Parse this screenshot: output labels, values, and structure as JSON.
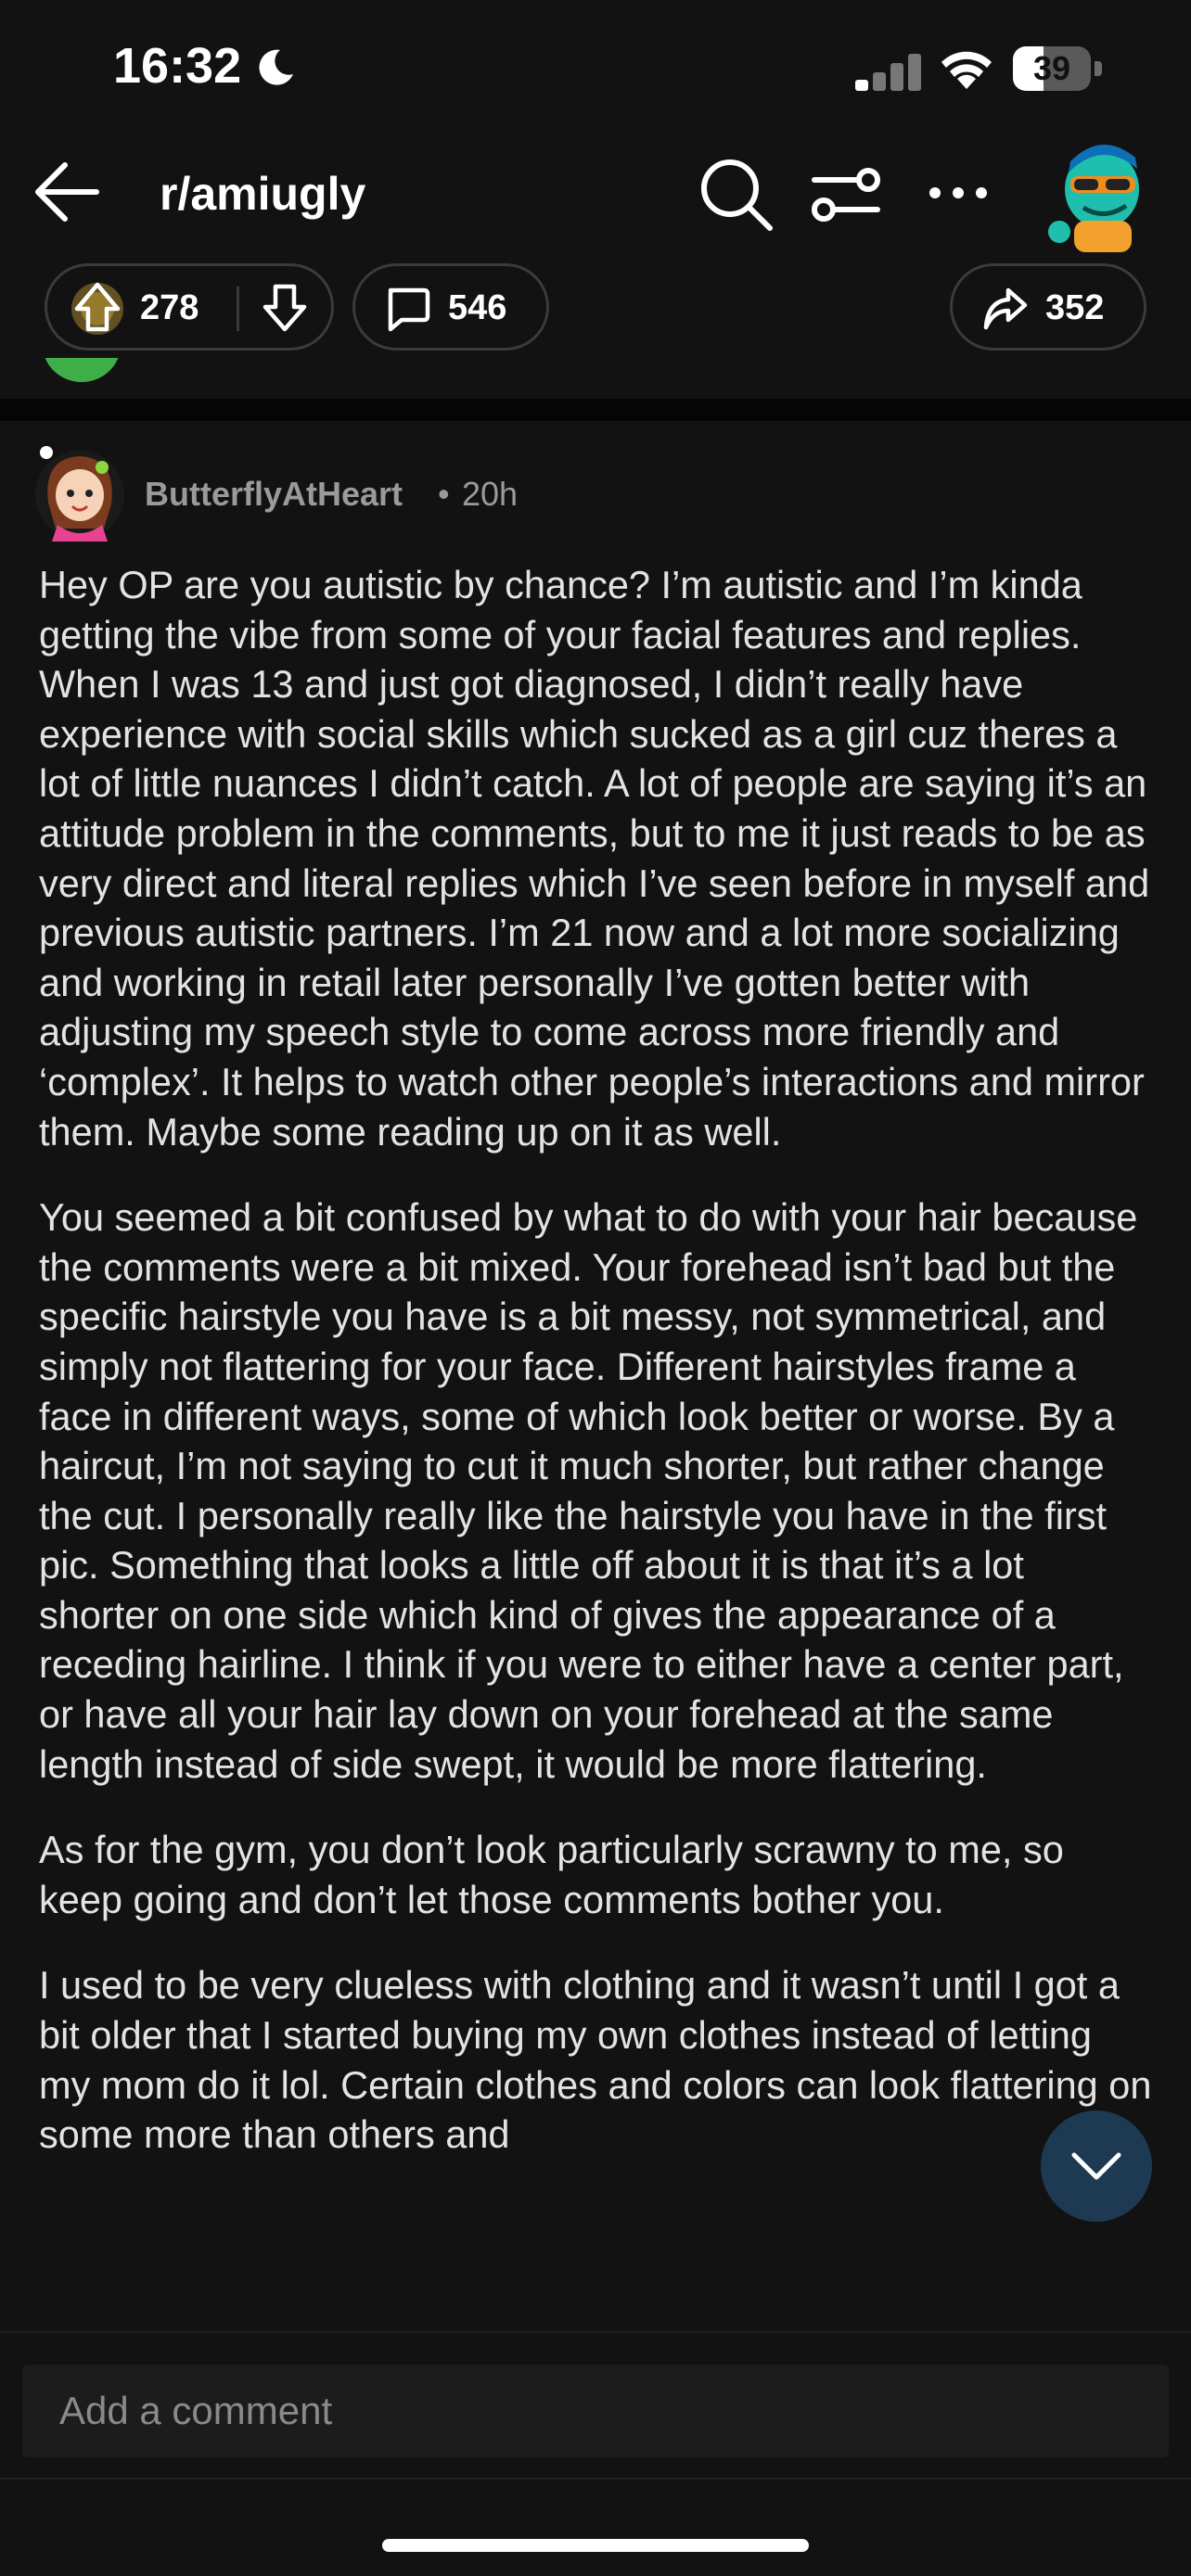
{
  "status_bar": {
    "time": "16:32",
    "battery": "39",
    "battery_level": 0.39
  },
  "nav": {
    "subreddit": "r/amiugly"
  },
  "actions": {
    "upvotes": "278",
    "comments": "546",
    "shares": "352"
  },
  "comment": {
    "author": "ButterflyAtHeart",
    "separator": "•",
    "age": "20h",
    "paragraphs": [
      "Hey OP are you autistic by chance? I’m autistic and I’m kinda getting the vibe from some of your facial features and replies. When I was 13 and just got diagnosed, I didn’t really have experience with social skills which sucked as a girl cuz theres a lot of little nuances I didn’t catch. A lot of people are saying it’s an attitude problem in the comments, but to me it just reads to be as very direct and literal replies which I’ve seen before in myself and previous autistic partners. I’m 21 now and a lot more socializing and working in retail later personally I’ve gotten better with adjusting my speech style to come across more friendly and ‘complex’. It helps to watch other people’s interactions and mirror them. Maybe some reading up on it as well.",
      "You seemed a bit confused by what to do with your hair because the comments were a bit mixed. Your forehead isn’t bad but the specific hairstyle you have is a bit messy, not symmetrical, and simply not flattering for your face. Different hairstyles frame a face in different ways, some of which look better or worse. By a haircut, I’m not saying to cut it much shorter, but rather change the cut. I personally really like the hairstyle you have in the first pic. Something that looks a little off about it is that it’s a lot shorter on one side which kind of gives the appearance of a receding hairline. I think if you were to either have a center part, or have all your hair lay down on your forehead at the same length instead of side swept, it would be more flattering.",
      "As for the gym, you don’t look particularly scrawny to me, so keep going and don’t let those comments bother you.",
      "I used to be very clueless with clothing and it wasn’t until I got a bit older that I started buying my own clothes instead of letting my mom do it lol. Certain clothes and colors can look flattering on some more than others and"
    ]
  },
  "composer": {
    "placeholder": "Add a comment"
  },
  "colors": {
    "background": "#121212",
    "upvote_glow": "#f5c542",
    "fab": "#1e3a52"
  },
  "icons": [
    "moon-icon",
    "signal-icon",
    "wifi-icon",
    "battery-icon",
    "back-arrow-icon",
    "search-icon",
    "filter-icon",
    "more-icon",
    "upvote-icon",
    "downvote-icon",
    "comment-icon",
    "share-icon",
    "chevron-down-icon"
  ]
}
